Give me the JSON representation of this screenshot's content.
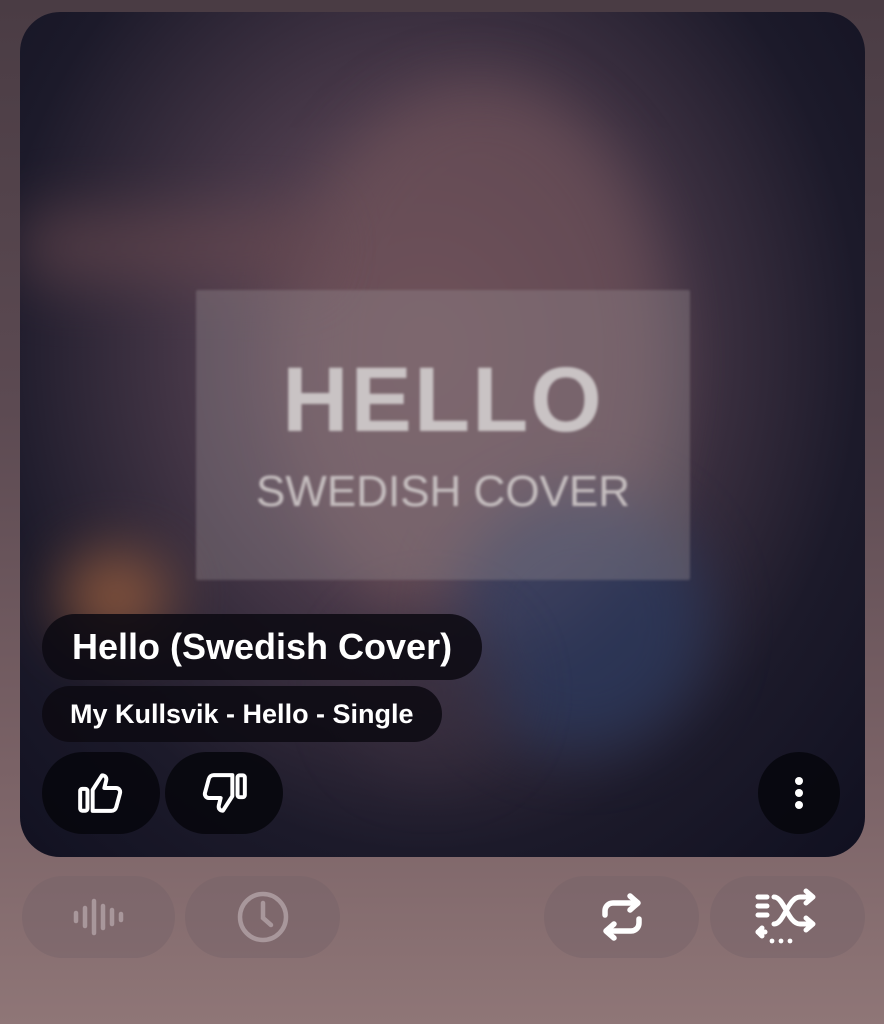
{
  "now_playing": {
    "song_title": "Hello (Swedish Cover)",
    "subtitle": "My Kullsvik - Hello - Single",
    "artwork": {
      "title_text": "HELLO",
      "subtitle_text": "SWEDISH COVER"
    }
  },
  "actions": {
    "like_icon": "thumbs-up-icon",
    "dislike_icon": "thumbs-down-icon",
    "more_icon": "more-vertical-icon"
  },
  "controls": {
    "items": [
      {
        "name": "audio-wave-button",
        "icon": "audio-wave-icon",
        "state": "dimmed"
      },
      {
        "name": "sleep-timer-button",
        "icon": "clock-icon",
        "state": "dimmed"
      },
      {
        "name": "repeat-button",
        "icon": "repeat-icon",
        "state": "active"
      },
      {
        "name": "shuffle-button",
        "icon": "shuffle-icon",
        "state": "active"
      }
    ]
  },
  "colors": {
    "pill_background": "#0c0a12",
    "text": "#ffffff",
    "dimmed_icon": "#a8979b"
  }
}
